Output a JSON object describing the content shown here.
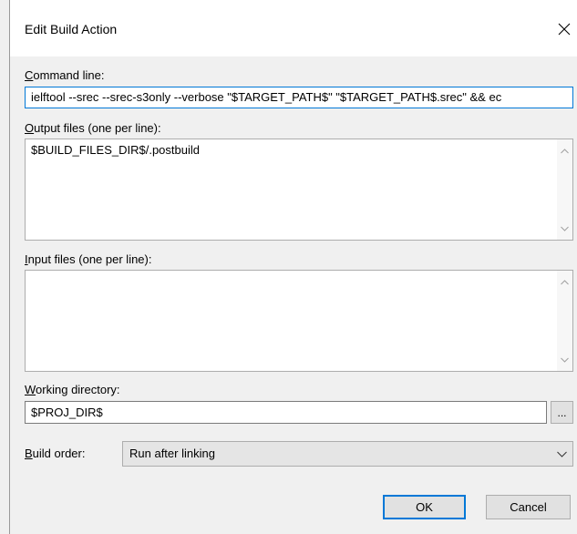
{
  "dialog": {
    "title": "Edit Build Action"
  },
  "command_line": {
    "label_access": "C",
    "label_rest": "ommand line:",
    "value": "ielftool --srec --srec-s3only --verbose \"$TARGET_PATH$\" \"$TARGET_PATH$.srec\" && ec"
  },
  "output_files": {
    "label_access": "O",
    "label_rest": "utput files (one per line):",
    "value": "$BUILD_FILES_DIR$/.postbuild"
  },
  "input_files": {
    "label_access": "I",
    "label_rest": "nput files (one per line):",
    "value": ""
  },
  "working_directory": {
    "label_access": "W",
    "label_rest": "orking directory:",
    "value": "$PROJ_DIR$",
    "browse_label": "..."
  },
  "build_order": {
    "label_access": "B",
    "label_rest": "uild order:",
    "selected": "Run after linking"
  },
  "buttons": {
    "ok": "OK",
    "cancel": "Cancel"
  },
  "icons": {
    "close": "close-icon",
    "scroll_up": "chevron-up-icon",
    "scroll_down": "chevron-down-icon",
    "dropdown": "chevron-down-icon"
  }
}
